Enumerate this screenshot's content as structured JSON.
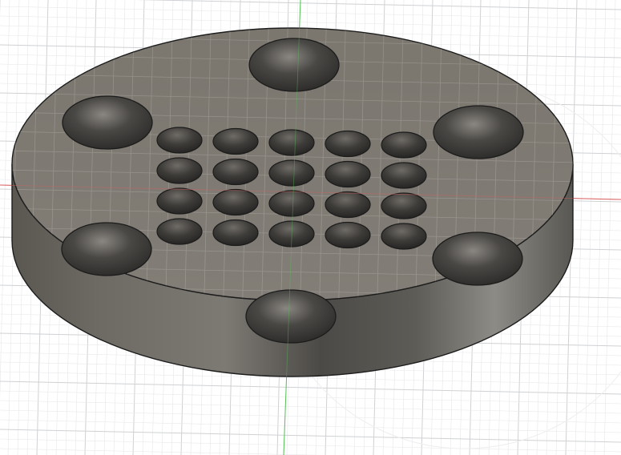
{
  "viewport": {
    "label": "",
    "background_color": "#ffffff",
    "grid": {
      "minor_color": "#e6e7e9",
      "major_color": "#cfd1d4",
      "visible": true
    },
    "axes": {
      "x_axis_color": "#e06060",
      "y_axis_color": "#58c058"
    }
  },
  "part": {
    "shape": "circular-disc",
    "top_face_color": "#7e7a73",
    "side_color": "#5f5c56",
    "edge_color": "#1c1c1c",
    "large_holes": {
      "count": 6
    },
    "small_hole_grid": {
      "rows": 4,
      "columns": 5,
      "count": 20
    }
  }
}
